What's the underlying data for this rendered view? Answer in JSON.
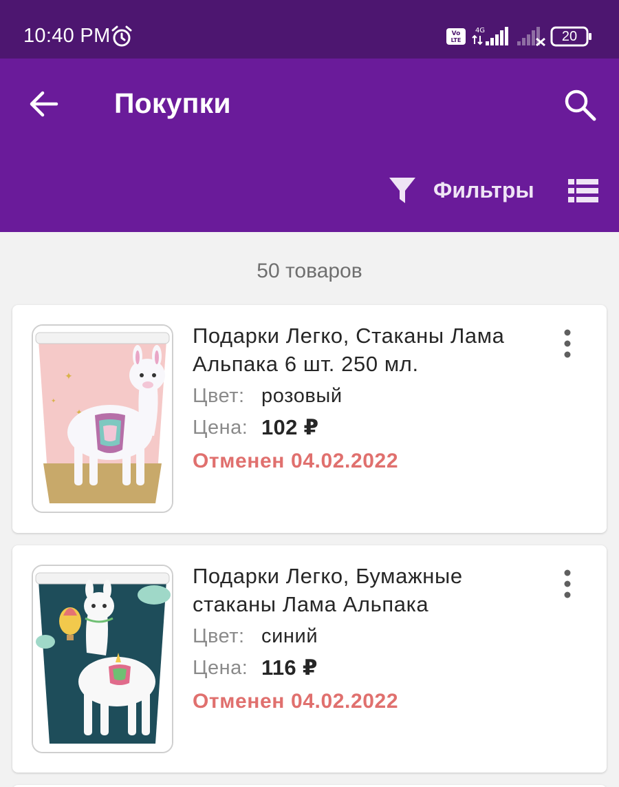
{
  "status_bar": {
    "time": "10:40 PM",
    "volte": "Vo LTE",
    "network": "4G",
    "battery": "20"
  },
  "app_bar": {
    "title": "Покупки",
    "filters_label": "Фильтры"
  },
  "list": {
    "count_label": "50 товаров",
    "items": [
      {
        "title": "Подарки Легко, Стаканы Лама Альпака 6 шт. 250 мл.",
        "color_label": "Цвет:",
        "color_value": "розовый",
        "price_label": "Цена:",
        "price_value": "102 ₽",
        "status": "Отменен 04.02.2022",
        "image": "pink-llama-cup"
      },
      {
        "title": "Подарки Легко, Бумажные стаканы Лама Альпака",
        "color_label": "Цвет:",
        "color_value": "синий",
        "price_label": "Цена:",
        "price_value": "116 ₽",
        "status": "Отменен 04.02.2022",
        "image": "blue-llama-cup"
      }
    ]
  },
  "colors": {
    "status_bar": "#4d1670",
    "app_bar": "#6a1b9a",
    "cancelled": "#e0706e"
  }
}
